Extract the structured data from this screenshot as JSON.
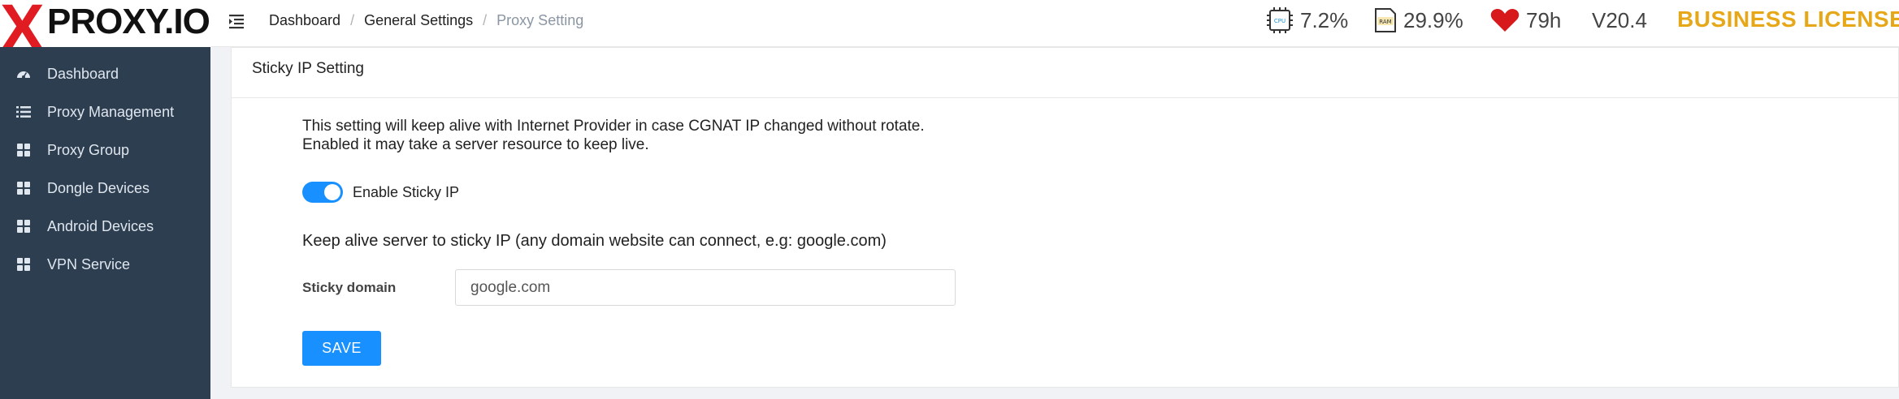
{
  "brand": {
    "logo_x": "X",
    "logo_text": "PROXY.IO"
  },
  "breadcrumb": {
    "items": [
      "Dashboard",
      "General Settings"
    ],
    "current": "Proxy Setting",
    "separator": "/"
  },
  "stats": {
    "cpu": "7.2%",
    "ram": "29.9%",
    "uptime": "79h",
    "version": "V20.4",
    "license": "BUSINESS LICENSE",
    "license_color": "#e6a818"
  },
  "sidebar": {
    "items": [
      {
        "label": "Dashboard",
        "icon": "dashboard-icon"
      },
      {
        "label": "Proxy Management",
        "icon": "list-icon"
      },
      {
        "label": "Proxy Group",
        "icon": "grid-icon"
      },
      {
        "label": "Dongle Devices",
        "icon": "grid-icon"
      },
      {
        "label": "Android Devices",
        "icon": "grid-icon"
      },
      {
        "label": "VPN Service",
        "icon": "grid-icon"
      }
    ]
  },
  "card": {
    "title": "Sticky IP Setting",
    "description_line1": "This setting will keep alive with Internet Provider in case CGNAT IP changed without rotate.",
    "description_line2": "Enabled it may take a server resource to keep live.",
    "toggle_label": "Enable Sticky IP",
    "toggle_on": true,
    "keep_alive_text": "Keep alive server to sticky IP (any domain website can connect, e.g: google.com)",
    "field_label": "Sticky domain",
    "field_value": "google.com",
    "save_label": "SAVE"
  },
  "colors": {
    "accent": "#1890ff",
    "sidebar_bg": "#2d3e50",
    "logo_red": "#e01b22"
  }
}
